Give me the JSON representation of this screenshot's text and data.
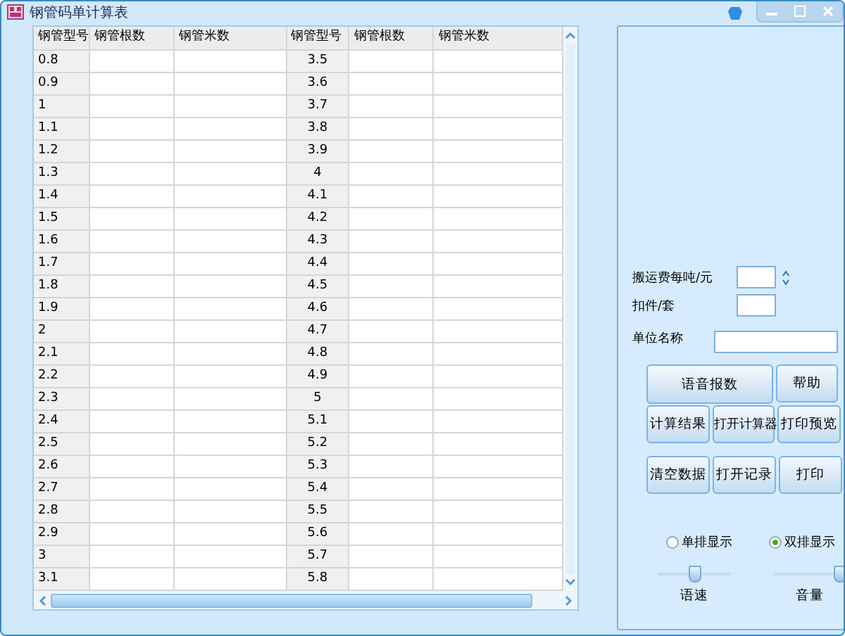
{
  "window": {
    "title": "钢管码单计算表"
  },
  "table": {
    "columns": [
      "钢管型号",
      "钢管根数",
      "钢管米数",
      "钢管型号",
      "钢管根数",
      "钢管米数"
    ],
    "rows": [
      [
        "0.8",
        "3.5"
      ],
      [
        "0.9",
        "3.6"
      ],
      [
        "1",
        "3.7"
      ],
      [
        "1.1",
        "3.8"
      ],
      [
        "1.2",
        "3.9"
      ],
      [
        "1.3",
        "4"
      ],
      [
        "1.4",
        "4.1"
      ],
      [
        "1.5",
        "4.2"
      ],
      [
        "1.6",
        "4.3"
      ],
      [
        "1.7",
        "4.4"
      ],
      [
        "1.8",
        "4.5"
      ],
      [
        "1.9",
        "4.6"
      ],
      [
        "2",
        "4.7"
      ],
      [
        "2.1",
        "4.8"
      ],
      [
        "2.2",
        "4.9"
      ],
      [
        "2.3",
        "5"
      ],
      [
        "2.4",
        "5.1"
      ],
      [
        "2.5",
        "5.2"
      ],
      [
        "2.6",
        "5.3"
      ],
      [
        "2.7",
        "5.4"
      ],
      [
        "2.8",
        "5.5"
      ],
      [
        "2.9",
        "5.6"
      ],
      [
        "3",
        "5.7"
      ],
      [
        "3.1",
        "5.8"
      ]
    ]
  },
  "form": {
    "fields": [
      {
        "label": "搬运费每吨/元",
        "kind": "spinner"
      },
      {
        "label": "扣件/套",
        "kind": "short"
      },
      {
        "label": "单位名称",
        "kind": "wide"
      }
    ]
  },
  "buttons": [
    [
      "语音报数",
      "帮助"
    ],
    [
      "计算结果",
      "打开计算器",
      "打印预览"
    ],
    [
      "清空数据",
      "打开记录",
      "打印"
    ]
  ],
  "display_mode": [
    {
      "label": "单排显示",
      "selected": false
    },
    {
      "label": "双排显示",
      "selected": true
    }
  ],
  "sliders": [
    {
      "label": "语速",
      "level": 0.5
    },
    {
      "label": "音量",
      "level": 1
    }
  ]
}
